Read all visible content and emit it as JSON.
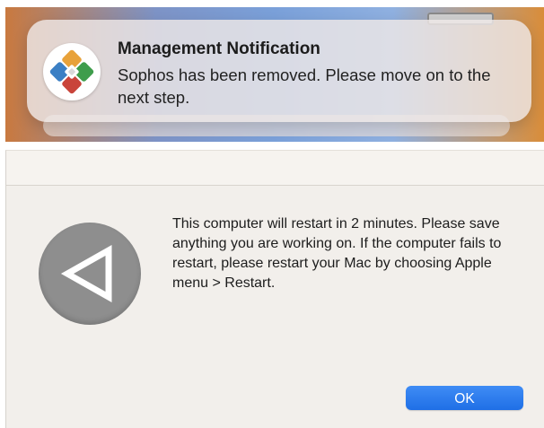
{
  "notification": {
    "title": "Management Notification",
    "body": "Sophos has been removed. Please move on to the next step.",
    "icon": "self-service-app-icon"
  },
  "dialog": {
    "message": "This computer will restart in 2 minutes. Please save anything you are working on. If the computer fails to restart, please restart your Mac by choosing Apple menu > Restart.",
    "icon": "restart-triangle-icon",
    "ok_label": "OK"
  },
  "colors": {
    "accent": "#2a7cf0",
    "dialog_background": "#f2efeb",
    "icon_circle": "#8e8e8e"
  }
}
